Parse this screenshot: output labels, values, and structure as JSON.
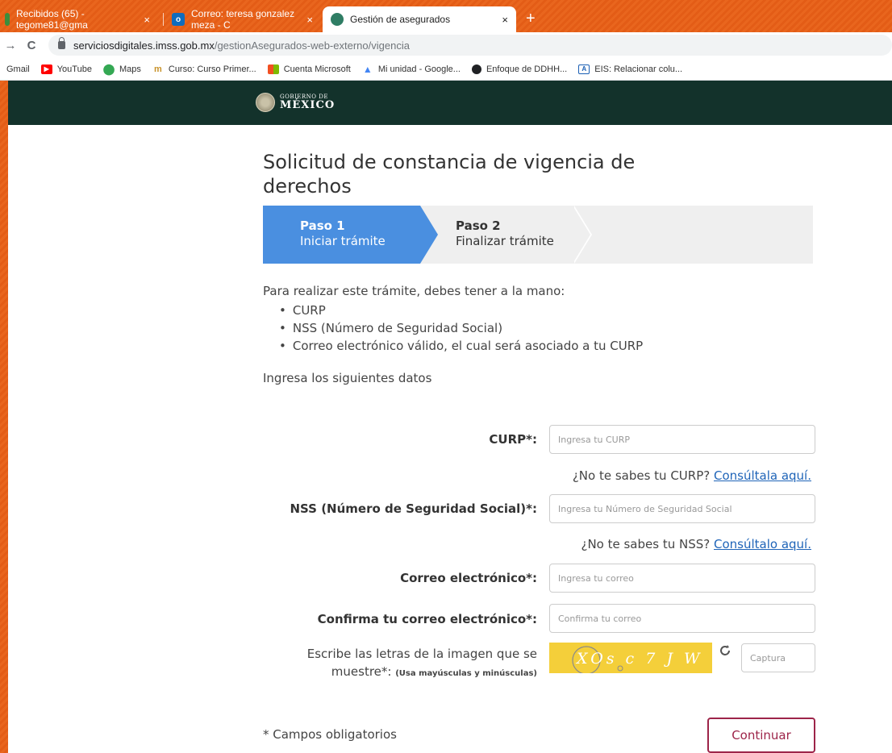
{
  "browser": {
    "tabs": [
      {
        "title": "Recibidos (65) - tegome81@gma",
        "close": "×",
        "active": false,
        "favicon_color": "#3c8d3c"
      },
      {
        "title": "Correo: teresa gonzalez meza - C",
        "close": "×",
        "active": false,
        "favicon_color": "#0f6cbd",
        "favicon_letter": "o"
      },
      {
        "title": "Gestión de asegurados",
        "close": "×",
        "active": true,
        "favicon_color": "#2f7d64"
      }
    ],
    "new_tab": "+",
    "url_host": "serviciosdigitales.imss.gob.mx",
    "url_path": "/gestionAsegurados-web-externo/vigencia",
    "back": "←",
    "forward": "→",
    "reload": "C",
    "bookmarks": [
      {
        "label": "Gmail",
        "icon": "gmail-icon",
        "color": ""
      },
      {
        "label": "YouTube",
        "icon": "youtube-icon",
        "color": "#ff0000"
      },
      {
        "label": "Maps",
        "icon": "maps-icon",
        "color": "#34a853"
      },
      {
        "label": "Curso: Curso Primer...",
        "icon": "course-icon",
        "color": "#c8922a"
      },
      {
        "label": "Cuenta Microsoft",
        "icon": "microsoft-icon",
        "color": "#f25022"
      },
      {
        "label": "Mi unidad - Google...",
        "icon": "google-drive-icon",
        "color": "#4285f4"
      },
      {
        "label": "Enfoque de DDHH...",
        "icon": "google-icon",
        "color": "#202124"
      },
      {
        "label": "EIS: Relacionar colu...",
        "icon": "eis-icon",
        "color": "#1a5fb4"
      }
    ]
  },
  "header": {
    "logo_line1": "GOBIERNO DE",
    "logo_line2": "MÉXICO"
  },
  "main": {
    "title": "Solicitud de constancia de vigencia de derechos",
    "steps": [
      {
        "name": "Paso 1",
        "desc": "Iniciar trámite"
      },
      {
        "name": "Paso 2",
        "desc": "Finalizar trámite"
      }
    ],
    "intro": "Para realizar este trámite, debes tener a la mano:",
    "requirements": [
      "CURP",
      "NSS (Número de Seguridad Social)",
      "Correo electrónico válido, el cual será asociado a tu CURP"
    ],
    "subtitle": "Ingresa los siguientes datos"
  },
  "form": {
    "curp_label": "CURP*:",
    "curp_placeholder": "Ingresa tu CURP",
    "curp_help": "¿No te sabes tu CURP?",
    "curp_help_link": "Consúltala aquí.",
    "nss_label": "NSS (Número de Seguridad Social)*:",
    "nss_placeholder": "Ingresa tu Número de Seguridad Social",
    "nss_help": "¿No te sabes tu NSS?",
    "nss_help_link": "Consúltalo aquí.",
    "email_label": "Correo electrónico*:",
    "email_placeholder": "Ingresa tu correo",
    "confirm_label": "Confirma tu correo electrónico*:",
    "confirm_placeholder": "Confirma tu correo",
    "captcha_label_line1": "Escribe las letras de la imagen que se",
    "captcha_label_line2": "muestre*:",
    "captcha_note": "(Usa mayúsculas y minúsculas)",
    "captcha_text": "XOs c 7 J W",
    "captcha_placeholder": "Captura",
    "required_note": "* Campos obligatorios",
    "continue_label": "Continuar"
  },
  "colors": {
    "gov_header": "#13322b",
    "step_active": "#4a8fe0",
    "button_accent": "#9d2449",
    "link": "#1f64b8"
  }
}
